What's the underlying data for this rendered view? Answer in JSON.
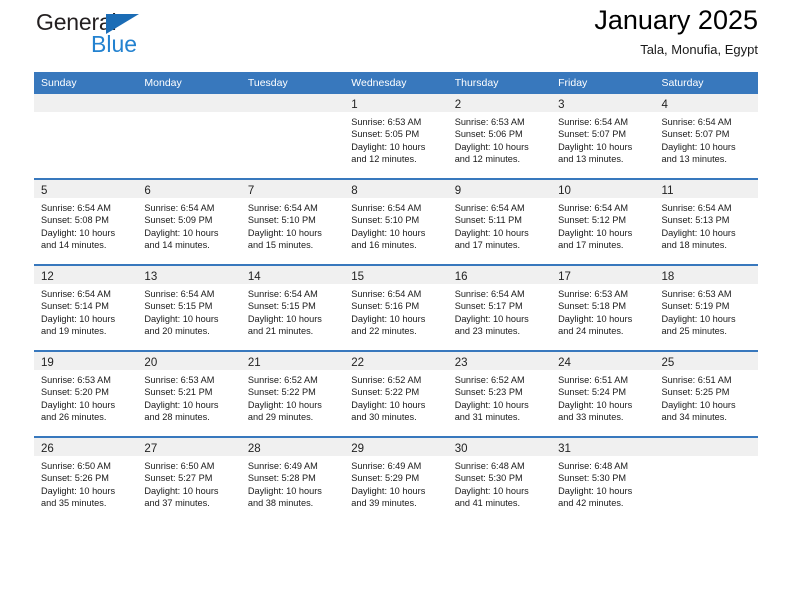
{
  "brand": {
    "name_top": "General",
    "name_bottom": "Blue",
    "triangle_icon": "triangle-icon",
    "color_dark": "#231f20",
    "color_blue": "#2382d0"
  },
  "header": {
    "title": "January 2025",
    "subtitle": "Tala, Monufia, Egypt"
  },
  "theme": {
    "header_bg": "#3878bd",
    "header_text": "#ffffff",
    "daynum_band_bg": "#f0f0f0",
    "cell_bg": "#ffffff",
    "row_divider": "#3878bd"
  },
  "weekday_headers": [
    "Sunday",
    "Monday",
    "Tuesday",
    "Wednesday",
    "Thursday",
    "Friday",
    "Saturday"
  ],
  "weeks": [
    [
      {
        "day": "",
        "lines": []
      },
      {
        "day": "",
        "lines": []
      },
      {
        "day": "",
        "lines": []
      },
      {
        "day": "1",
        "lines": [
          "Sunrise: 6:53 AM",
          "Sunset: 5:05 PM",
          "Daylight: 10 hours",
          "and 12 minutes."
        ]
      },
      {
        "day": "2",
        "lines": [
          "Sunrise: 6:53 AM",
          "Sunset: 5:06 PM",
          "Daylight: 10 hours",
          "and 12 minutes."
        ]
      },
      {
        "day": "3",
        "lines": [
          "Sunrise: 6:54 AM",
          "Sunset: 5:07 PM",
          "Daylight: 10 hours",
          "and 13 minutes."
        ]
      },
      {
        "day": "4",
        "lines": [
          "Sunrise: 6:54 AM",
          "Sunset: 5:07 PM",
          "Daylight: 10 hours",
          "and 13 minutes."
        ]
      }
    ],
    [
      {
        "day": "5",
        "lines": [
          "Sunrise: 6:54 AM",
          "Sunset: 5:08 PM",
          "Daylight: 10 hours",
          "and 14 minutes."
        ]
      },
      {
        "day": "6",
        "lines": [
          "Sunrise: 6:54 AM",
          "Sunset: 5:09 PM",
          "Daylight: 10 hours",
          "and 14 minutes."
        ]
      },
      {
        "day": "7",
        "lines": [
          "Sunrise: 6:54 AM",
          "Sunset: 5:10 PM",
          "Daylight: 10 hours",
          "and 15 minutes."
        ]
      },
      {
        "day": "8",
        "lines": [
          "Sunrise: 6:54 AM",
          "Sunset: 5:10 PM",
          "Daylight: 10 hours",
          "and 16 minutes."
        ]
      },
      {
        "day": "9",
        "lines": [
          "Sunrise: 6:54 AM",
          "Sunset: 5:11 PM",
          "Daylight: 10 hours",
          "and 17 minutes."
        ]
      },
      {
        "day": "10",
        "lines": [
          "Sunrise: 6:54 AM",
          "Sunset: 5:12 PM",
          "Daylight: 10 hours",
          "and 17 minutes."
        ]
      },
      {
        "day": "11",
        "lines": [
          "Sunrise: 6:54 AM",
          "Sunset: 5:13 PM",
          "Daylight: 10 hours",
          "and 18 minutes."
        ]
      }
    ],
    [
      {
        "day": "12",
        "lines": [
          "Sunrise: 6:54 AM",
          "Sunset: 5:14 PM",
          "Daylight: 10 hours",
          "and 19 minutes."
        ]
      },
      {
        "day": "13",
        "lines": [
          "Sunrise: 6:54 AM",
          "Sunset: 5:15 PM",
          "Daylight: 10 hours",
          "and 20 minutes."
        ]
      },
      {
        "day": "14",
        "lines": [
          "Sunrise: 6:54 AM",
          "Sunset: 5:15 PM",
          "Daylight: 10 hours",
          "and 21 minutes."
        ]
      },
      {
        "day": "15",
        "lines": [
          "Sunrise: 6:54 AM",
          "Sunset: 5:16 PM",
          "Daylight: 10 hours",
          "and 22 minutes."
        ]
      },
      {
        "day": "16",
        "lines": [
          "Sunrise: 6:54 AM",
          "Sunset: 5:17 PM",
          "Daylight: 10 hours",
          "and 23 minutes."
        ]
      },
      {
        "day": "17",
        "lines": [
          "Sunrise: 6:53 AM",
          "Sunset: 5:18 PM",
          "Daylight: 10 hours",
          "and 24 minutes."
        ]
      },
      {
        "day": "18",
        "lines": [
          "Sunrise: 6:53 AM",
          "Sunset: 5:19 PM",
          "Daylight: 10 hours",
          "and 25 minutes."
        ]
      }
    ],
    [
      {
        "day": "19",
        "lines": [
          "Sunrise: 6:53 AM",
          "Sunset: 5:20 PM",
          "Daylight: 10 hours",
          "and 26 minutes."
        ]
      },
      {
        "day": "20",
        "lines": [
          "Sunrise: 6:53 AM",
          "Sunset: 5:21 PM",
          "Daylight: 10 hours",
          "and 28 minutes."
        ]
      },
      {
        "day": "21",
        "lines": [
          "Sunrise: 6:52 AM",
          "Sunset: 5:22 PM",
          "Daylight: 10 hours",
          "and 29 minutes."
        ]
      },
      {
        "day": "22",
        "lines": [
          "Sunrise: 6:52 AM",
          "Sunset: 5:22 PM",
          "Daylight: 10 hours",
          "and 30 minutes."
        ]
      },
      {
        "day": "23",
        "lines": [
          "Sunrise: 6:52 AM",
          "Sunset: 5:23 PM",
          "Daylight: 10 hours",
          "and 31 minutes."
        ]
      },
      {
        "day": "24",
        "lines": [
          "Sunrise: 6:51 AM",
          "Sunset: 5:24 PM",
          "Daylight: 10 hours",
          "and 33 minutes."
        ]
      },
      {
        "day": "25",
        "lines": [
          "Sunrise: 6:51 AM",
          "Sunset: 5:25 PM",
          "Daylight: 10 hours",
          "and 34 minutes."
        ]
      }
    ],
    [
      {
        "day": "26",
        "lines": [
          "Sunrise: 6:50 AM",
          "Sunset: 5:26 PM",
          "Daylight: 10 hours",
          "and 35 minutes."
        ]
      },
      {
        "day": "27",
        "lines": [
          "Sunrise: 6:50 AM",
          "Sunset: 5:27 PM",
          "Daylight: 10 hours",
          "and 37 minutes."
        ]
      },
      {
        "day": "28",
        "lines": [
          "Sunrise: 6:49 AM",
          "Sunset: 5:28 PM",
          "Daylight: 10 hours",
          "and 38 minutes."
        ]
      },
      {
        "day": "29",
        "lines": [
          "Sunrise: 6:49 AM",
          "Sunset: 5:29 PM",
          "Daylight: 10 hours",
          "and 39 minutes."
        ]
      },
      {
        "day": "30",
        "lines": [
          "Sunrise: 6:48 AM",
          "Sunset: 5:30 PM",
          "Daylight: 10 hours",
          "and 41 minutes."
        ]
      },
      {
        "day": "31",
        "lines": [
          "Sunrise: 6:48 AM",
          "Sunset: 5:30 PM",
          "Daylight: 10 hours",
          "and 42 minutes."
        ]
      },
      {
        "day": "",
        "lines": []
      }
    ]
  ]
}
